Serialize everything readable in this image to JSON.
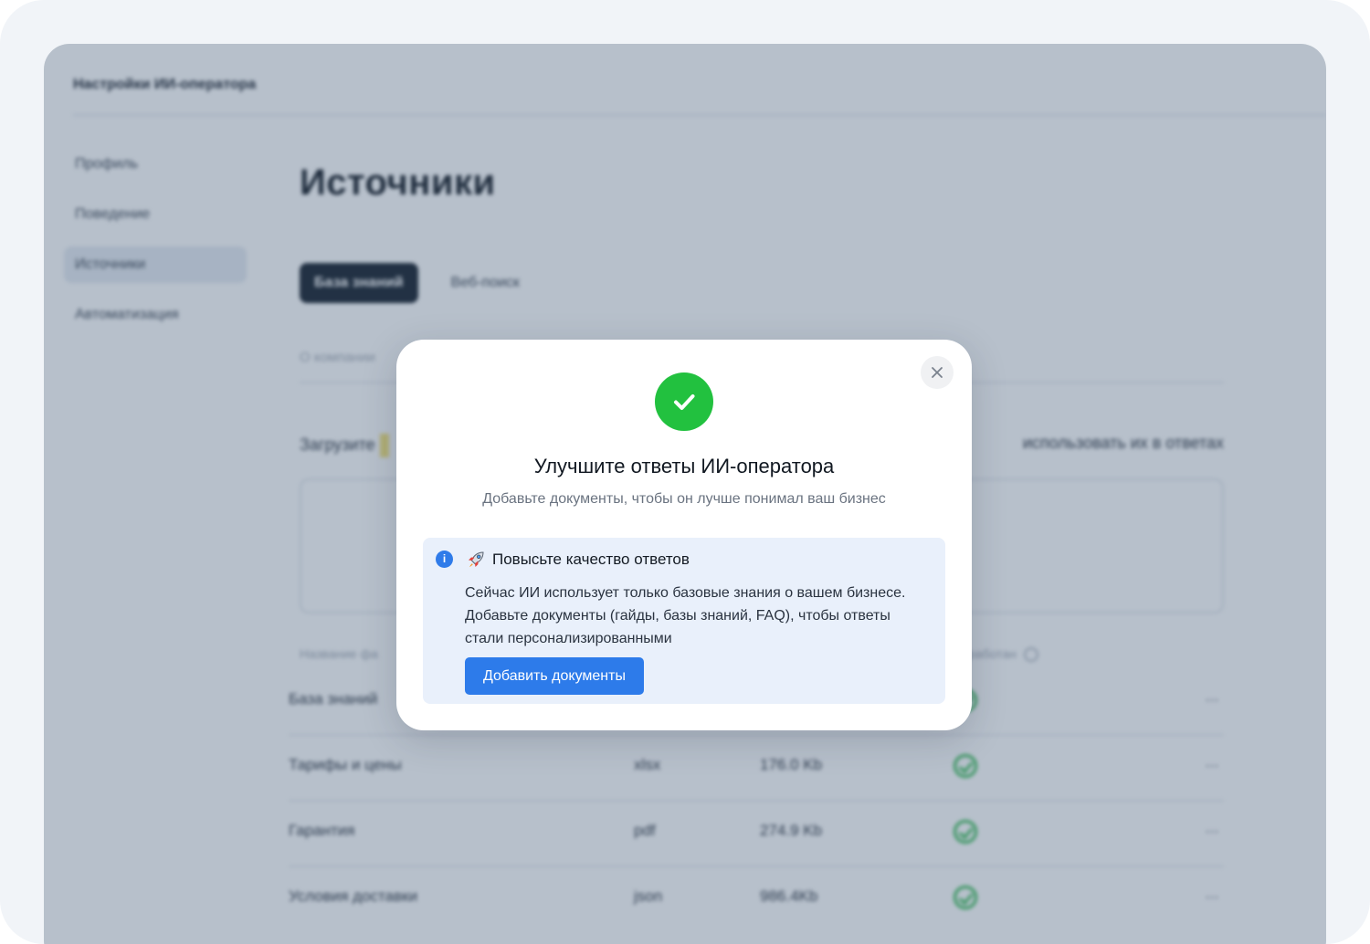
{
  "app": {
    "header_title": "Настройки ИИ-оператора"
  },
  "sidebar": {
    "items": [
      {
        "label": "Профиль"
      },
      {
        "label": "Поведение"
      },
      {
        "label": "Источники"
      },
      {
        "label": "Автоматизация"
      }
    ],
    "active_index": 2
  },
  "main": {
    "title": "Источники",
    "tabs": [
      {
        "label": "База знаний"
      },
      {
        "label": "Веб-поиск"
      }
    ],
    "subtab": "О компании",
    "upload_text_left": "Загрузите",
    "upload_text_right": "использовать их в ответах",
    "table_header_left": "Название фа",
    "table_header_right": "работан",
    "files": [
      {
        "name": "База знаний",
        "ext": "",
        "size": "",
        "menu": "···"
      },
      {
        "name": "Тарифы и цены",
        "ext": "xlsx",
        "size": "176.0 Kb",
        "menu": "···"
      },
      {
        "name": "Гарантия",
        "ext": "pdf",
        "size": "274.9 Kb",
        "menu": "···"
      },
      {
        "name": "Условия доставки",
        "ext": "json",
        "size": "986.4Kb",
        "menu": "···"
      }
    ]
  },
  "modal": {
    "title": "Улучшите ответы ИИ-оператора",
    "subtitle": "Добавьте документы, чтобы он лучше понимал ваш бизнес",
    "info": {
      "icon_letter": "i",
      "title": "Повысьте качество ответов",
      "text": "Сейчас ИИ использует только базовые знания о вашем бизнесе. Добавьте документы (гайды, базы знаний, FAQ), чтобы ответы стали персонализированными",
      "cta_label": "Добавить документы"
    }
  },
  "colors": {
    "accent": "#2d7bea",
    "success": "#22c13f",
    "overlay": "#38506e",
    "info_bg": "#e9f0fb"
  }
}
